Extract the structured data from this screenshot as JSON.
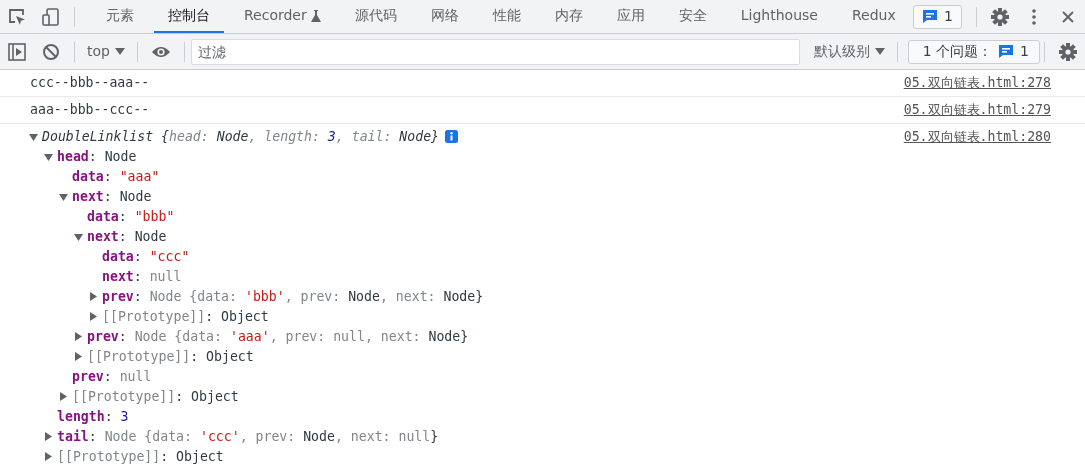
{
  "toolbar": {
    "tabs": [
      {
        "label": "元素",
        "selected": false,
        "kind": "plain"
      },
      {
        "label": "控制台",
        "selected": true,
        "kind": "plain"
      },
      {
        "label": "Recorder",
        "selected": false,
        "kind": "experimental"
      },
      {
        "label": "源代码",
        "selected": false,
        "kind": "plain"
      },
      {
        "label": "网络",
        "selected": false,
        "kind": "plain"
      },
      {
        "label": "性能",
        "selected": false,
        "kind": "plain"
      },
      {
        "label": "内存",
        "selected": false,
        "kind": "plain"
      },
      {
        "label": "应用",
        "selected": false,
        "kind": "plain"
      },
      {
        "label": "安全",
        "selected": false,
        "kind": "plain"
      },
      {
        "label": "Lighthouse",
        "selected": false,
        "kind": "plain"
      },
      {
        "label": "Redux",
        "selected": false,
        "kind": "plain"
      }
    ],
    "issues_count": "1"
  },
  "console_toolbar": {
    "context": "top",
    "filter": {
      "placeholder": "过滤"
    },
    "level": "默认级别",
    "issues_label": "1 个问题：",
    "issues_count": "1"
  },
  "console": {
    "messages": [
      {
        "kind": "text",
        "text": "ccc--bbb--aaa--",
        "source": "05.双向链表.html:278"
      },
      {
        "kind": "text",
        "text": "aaa--bbb--ccc--",
        "source": "05.双向链表.html:279"
      },
      {
        "kind": "object",
        "source": "05.双向链表.html:280",
        "root": {
          "kind": "object",
          "expanded": true,
          "segments": [
            {
              "kind": "type",
              "text": "DoubleLinklist "
            },
            {
              "kind": "brace",
              "text": "{"
            },
            {
              "kind": "pkey",
              "text": "head: "
            },
            {
              "kind": "type",
              "text": "Node"
            },
            {
              "kind": "pkey",
              "text": ", length: "
            },
            {
              "kind": "number",
              "text": "3"
            },
            {
              "kind": "pkey",
              "text": ", tail: "
            },
            {
              "kind": "type",
              "text": "Node"
            },
            {
              "kind": "brace",
              "text": "}"
            }
          ],
          "children": [
            {
              "kind": "object",
              "expanded": true,
              "segments": [
                {
                  "kind": "prop",
                  "text": "head"
                },
                {
                  "kind": "sep",
                  "text": ": "
                },
                {
                  "kind": "type",
                  "text": "Node"
                }
              ],
              "children": [
                {
                  "kind": "leaf",
                  "segments": [
                    {
                      "kind": "prop",
                      "text": "data"
                    },
                    {
                      "kind": "sep",
                      "text": ": "
                    },
                    {
                      "kind": "string",
                      "text": "\"aaa\""
                    }
                  ]
                },
                {
                  "kind": "object",
                  "expanded": true,
                  "segments": [
                    {
                      "kind": "prop",
                      "text": "next"
                    },
                    {
                      "kind": "sep",
                      "text": ": "
                    },
                    {
                      "kind": "type",
                      "text": "Node"
                    }
                  ],
                  "children": [
                    {
                      "kind": "leaf",
                      "segments": [
                        {
                          "kind": "prop",
                          "text": "data"
                        },
                        {
                          "kind": "sep",
                          "text": ": "
                        },
                        {
                          "kind": "string",
                          "text": "\"bbb\""
                        }
                      ]
                    },
                    {
                      "kind": "object",
                      "expanded": true,
                      "segments": [
                        {
                          "kind": "prop",
                          "text": "next"
                        },
                        {
                          "kind": "sep",
                          "text": ": "
                        },
                        {
                          "kind": "type",
                          "text": "Node"
                        }
                      ],
                      "children": [
                        {
                          "kind": "leaf",
                          "segments": [
                            {
                              "kind": "prop",
                              "text": "data"
                            },
                            {
                              "kind": "sep",
                              "text": ": "
                            },
                            {
                              "kind": "string",
                              "text": "\"ccc\""
                            }
                          ]
                        },
                        {
                          "kind": "leaf",
                          "segments": [
                            {
                              "kind": "prop",
                              "text": "next"
                            },
                            {
                              "kind": "sep",
                              "text": ": "
                            },
                            {
                              "kind": "null",
                              "text": "null"
                            }
                          ]
                        },
                        {
                          "kind": "object",
                          "expanded": false,
                          "segments": [
                            {
                              "kind": "prop",
                              "text": "prev"
                            },
                            {
                              "kind": "sep",
                              "text": ": "
                            },
                            {
                              "kind": "pkey",
                              "text": "Node {data: "
                            },
                            {
                              "kind": "string",
                              "text": "'bbb'"
                            },
                            {
                              "kind": "pkey",
                              "text": ", prev: "
                            },
                            {
                              "kind": "type",
                              "text": "Node"
                            },
                            {
                              "kind": "pkey",
                              "text": ", next: "
                            },
                            {
                              "kind": "type",
                              "text": "Node"
                            },
                            {
                              "kind": "brace",
                              "text": "}"
                            }
                          ]
                        },
                        {
                          "kind": "object",
                          "expanded": false,
                          "segments": [
                            {
                              "kind": "internal",
                              "text": "[[Prototype]]"
                            },
                            {
                              "kind": "sep",
                              "text": ": "
                            },
                            {
                              "kind": "type",
                              "text": "Object"
                            }
                          ]
                        }
                      ]
                    },
                    {
                      "kind": "object",
                      "expanded": false,
                      "segments": [
                        {
                          "kind": "prop",
                          "text": "prev"
                        },
                        {
                          "kind": "sep",
                          "text": ": "
                        },
                        {
                          "kind": "pkey",
                          "text": "Node {data: "
                        },
                        {
                          "kind": "string",
                          "text": "'aaa'"
                        },
                        {
                          "kind": "pkey",
                          "text": ", prev: "
                        },
                        {
                          "kind": "null",
                          "text": "null"
                        },
                        {
                          "kind": "pkey",
                          "text": ", next: "
                        },
                        {
                          "kind": "type",
                          "text": "Node"
                        },
                        {
                          "kind": "brace",
                          "text": "}"
                        }
                      ]
                    },
                    {
                      "kind": "object",
                      "expanded": false,
                      "segments": [
                        {
                          "kind": "internal",
                          "text": "[[Prototype]]"
                        },
                        {
                          "kind": "sep",
                          "text": ": "
                        },
                        {
                          "kind": "type",
                          "text": "Object"
                        }
                      ]
                    }
                  ]
                },
                {
                  "kind": "leaf",
                  "segments": [
                    {
                      "kind": "prop",
                      "text": "prev"
                    },
                    {
                      "kind": "sep",
                      "text": ": "
                    },
                    {
                      "kind": "null",
                      "text": "null"
                    }
                  ]
                },
                {
                  "kind": "object",
                  "expanded": false,
                  "segments": [
                    {
                      "kind": "internal",
                      "text": "[[Prototype]]"
                    },
                    {
                      "kind": "sep",
                      "text": ": "
                    },
                    {
                      "kind": "type",
                      "text": "Object"
                    }
                  ]
                }
              ]
            },
            {
              "kind": "leaf",
              "segments": [
                {
                  "kind": "prop",
                  "text": "length"
                },
                {
                  "kind": "sep",
                  "text": ": "
                },
                {
                  "kind": "number",
                  "text": "3"
                }
              ]
            },
            {
              "kind": "object",
              "expanded": false,
              "segments": [
                {
                  "kind": "prop",
                  "text": "tail"
                },
                {
                  "kind": "sep",
                  "text": ": "
                },
                {
                  "kind": "pkey",
                  "text": "Node {data: "
                },
                {
                  "kind": "string",
                  "text": "'ccc'"
                },
                {
                  "kind": "pkey",
                  "text": ", prev: "
                },
                {
                  "kind": "type",
                  "text": "Node"
                },
                {
                  "kind": "pkey",
                  "text": ", next: "
                },
                {
                  "kind": "null",
                  "text": "null"
                },
                {
                  "kind": "brace",
                  "text": "}"
                }
              ]
            },
            {
              "kind": "object",
              "expanded": false,
              "segments": [
                {
                  "kind": "internal",
                  "text": "[[Prototype]]"
                },
                {
                  "kind": "sep",
                  "text": ": "
                },
                {
                  "kind": "type",
                  "text": "Object"
                }
              ]
            }
          ]
        }
      }
    ]
  }
}
